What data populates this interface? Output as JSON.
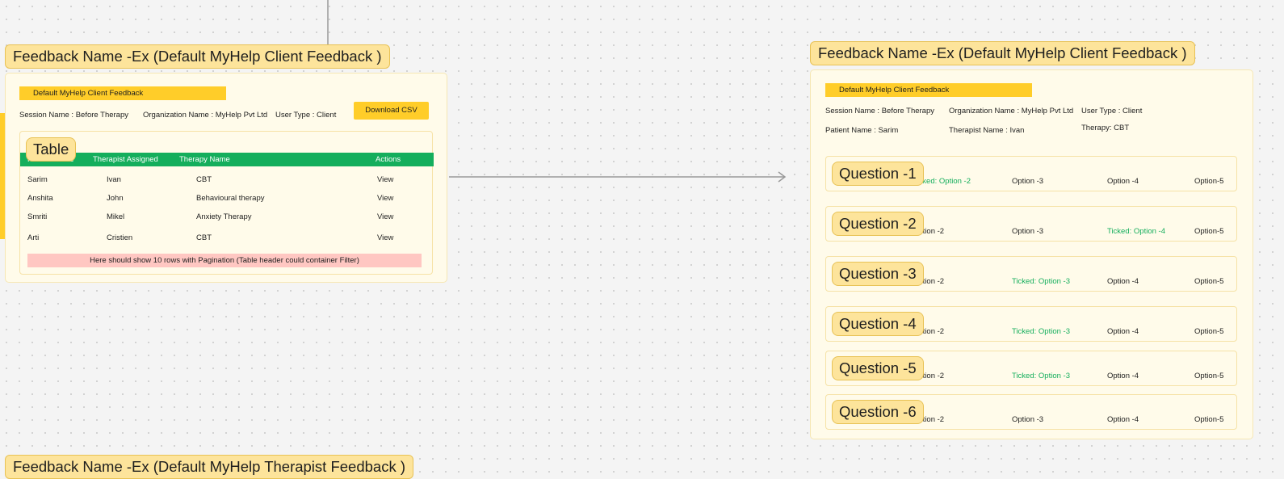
{
  "left_panel": {
    "title": "Feedback Name -Ex (Default MyHelp Client Feedback )",
    "strip_label": "Default MyHelp Client Feedback",
    "session": "Session Name : Before Therapy",
    "organization": "Organization Name : MyHelp Pvt Ltd",
    "user_type": "User Type : Client",
    "download_button": "Download CSV",
    "table_sticker": "Table",
    "table_headers": [
      "Patient Name",
      "Therapist Assigned",
      "Therapy Name",
      "Actions"
    ],
    "table_rows": [
      [
        "Sarim",
        "Ivan",
        "CBT",
        "View"
      ],
      [
        "Anshita",
        "John",
        "Behavioural therapy",
        "View"
      ],
      [
        "Smriti",
        "Mikel",
        "Anxiety Therapy",
        "View"
      ],
      [
        "Arti",
        "Cristien",
        "CBT",
        "View"
      ]
    ],
    "pagination_note": "Here should show 10 rows with Pagination (Table header could container Filter)"
  },
  "right_panel": {
    "title": "Feedback Name -Ex (Default MyHelp Client Feedback )",
    "strip_label": "Default MyHelp Client Feedback",
    "session": "Session Name : Before Therapy",
    "organization": "Organization Name : MyHelp Pvt Ltd",
    "user_type": "User Type : Client",
    "patient": "Patient Name : Sarim",
    "therapist": "Therapist Name : Ivan",
    "therapy": "Therapy: CBT",
    "questions": [
      {
        "label": "Question -1",
        "options": [
          "Option -1",
          "Ticked: Option -2",
          "Option -3",
          "Option -4",
          "Option-5"
        ],
        "ticked_index": 1
      },
      {
        "label": "Question -2",
        "options": [
          "Option -1",
          "Option -2",
          "Option -3",
          "Ticked: Option -4",
          "Option-5"
        ],
        "ticked_index": 3
      },
      {
        "label": "Question -3",
        "options": [
          "Option -1",
          "Option -2",
          "Ticked: Option -3",
          "Option -4",
          "Option-5"
        ],
        "ticked_index": 2
      },
      {
        "label": "Question -4",
        "options": [
          "Option -1",
          "Option -2",
          "Ticked: Option -3",
          "Option -4",
          "Option-5"
        ],
        "ticked_index": 2
      },
      {
        "label": "Question -5",
        "options": [
          "Option -1",
          "Option -2",
          "Ticked: Option -3",
          "Option -4",
          "Option-5"
        ],
        "ticked_index": 2
      },
      {
        "label": "Question -6",
        "options": [
          "Ticked: Option -1",
          "Option -2",
          "Option -3",
          "Option -4",
          "Option-5"
        ],
        "ticked_index": 0
      }
    ]
  },
  "bottom_panel": {
    "title": "Feedback Name -Ex (Default MyHelp Therapist Feedback )"
  },
  "colors": {
    "accent_yellow": "#ffcd29",
    "table_header_green": "#14ae5c",
    "ticked_green": "#14ae5c",
    "note_pink": "#ffc7c2"
  }
}
